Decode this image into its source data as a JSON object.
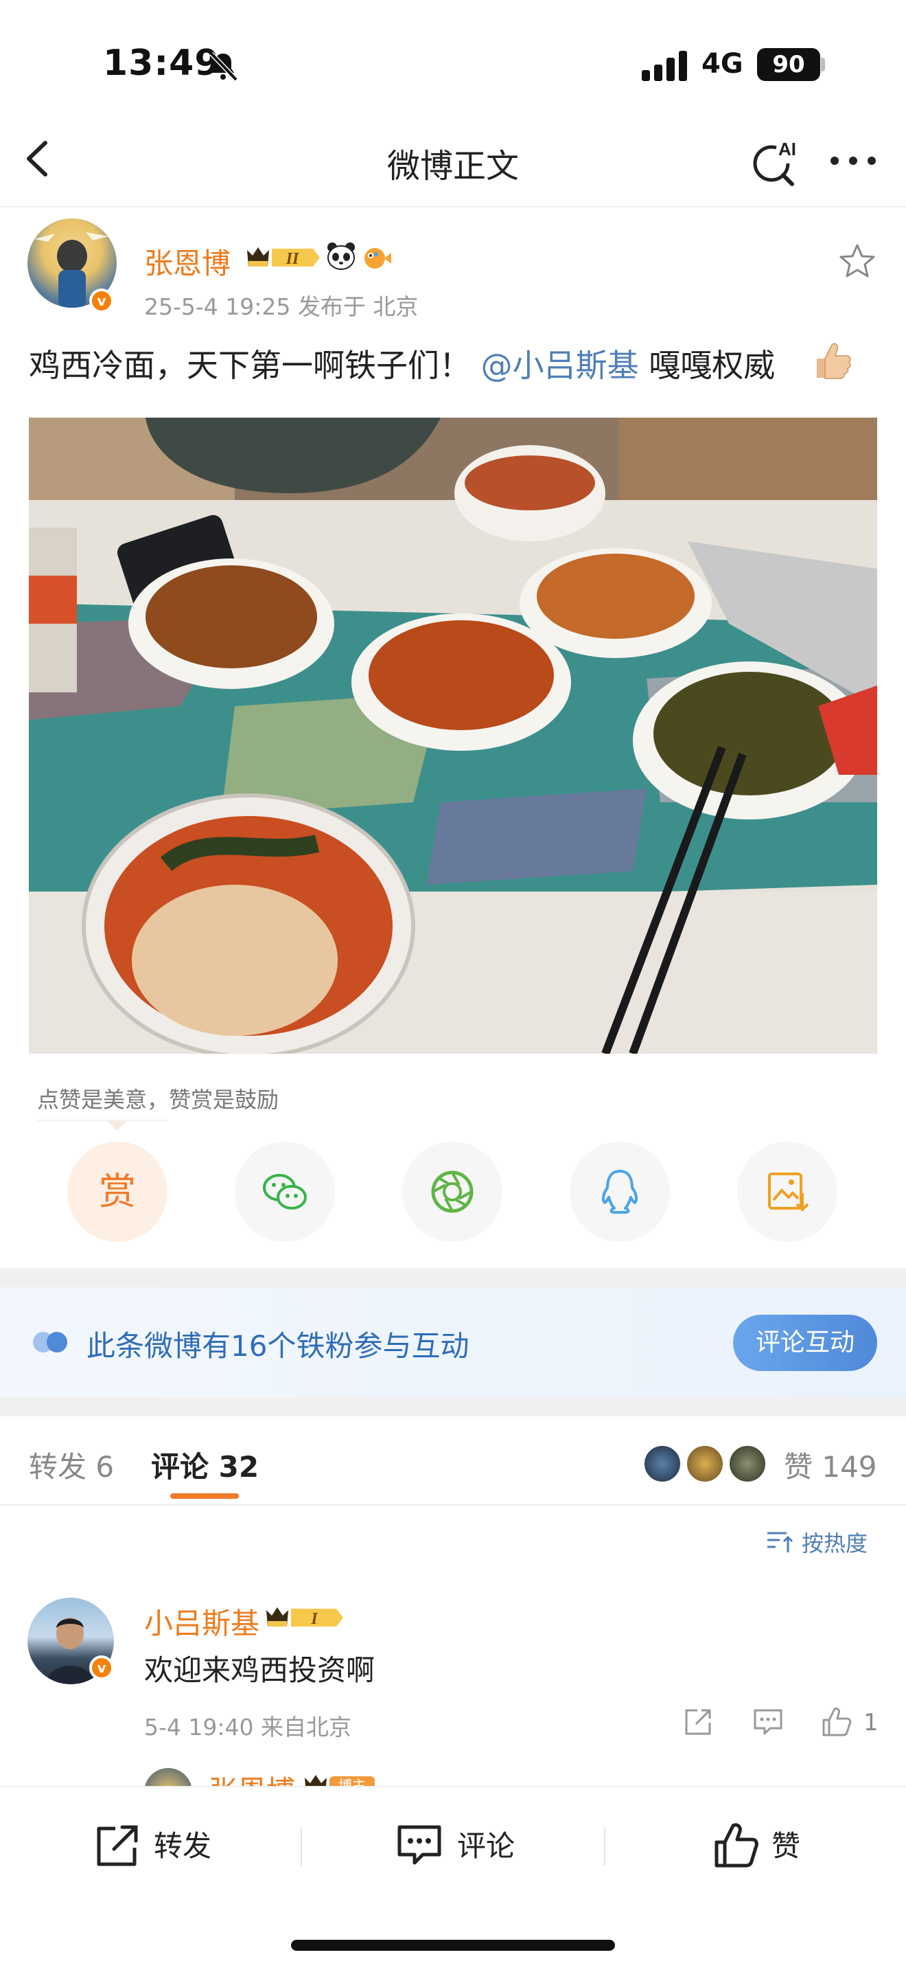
{
  "status_bar": {
    "time": "13:49",
    "network": "4G",
    "battery": "90"
  },
  "nav": {
    "title": "微博正文",
    "ai_label": "AI"
  },
  "post": {
    "author": "张恩博",
    "level_badge": "II",
    "meta": "25-5-4 19:25  发布于 北京",
    "text_before": "鸡西冷面，天下第一啊铁子们！ ",
    "mention": "@小吕斯基",
    "text_after": " 嘎嘎权威",
    "verified_mark": "v"
  },
  "reward": {
    "tip": "点赞是美意，赞赏是鼓励",
    "reward_label": "赏"
  },
  "fan_banner": {
    "text": "此条微博有16个铁粉参与互动",
    "button": "评论互动"
  },
  "tabs": {
    "repost": "转发 6",
    "comment": "评论 32",
    "likes": "赞 149"
  },
  "sort": {
    "label": "按热度"
  },
  "comments": [
    {
      "author": "小吕斯基",
      "level_badge": "I",
      "text": "欢迎来鸡西投资啊",
      "meta": "5-4 19:40  来自北京",
      "likes": "1"
    }
  ],
  "reply_preview": {
    "author": "张恩博",
    "badge": "博主"
  },
  "bottom_bar": {
    "repost": "转发",
    "comment": "评论",
    "like": "赞"
  },
  "colors": {
    "accent_orange": "#f07b2a",
    "link_blue": "#4f7eb7",
    "banner_blue": "#2f6db9"
  },
  "icons": [
    "back-icon",
    "ai-search-icon",
    "more-icon",
    "star-icon",
    "wechat-icon",
    "moments-icon",
    "qq-icon",
    "save-image-icon",
    "sort-icon",
    "share-icon",
    "comment-icon",
    "like-icon"
  ]
}
